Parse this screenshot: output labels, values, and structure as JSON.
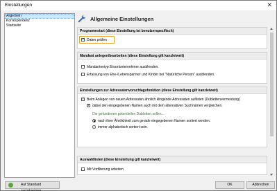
{
  "window": {
    "title": "Einstellungen"
  },
  "nav": {
    "items": [
      {
        "label": "Allgemein"
      },
      {
        "label": "Korrespondenz"
      },
      {
        "label": "Startseite"
      }
    ]
  },
  "header": {
    "title": "Allgemeine Einstellungen"
  },
  "panels": {
    "programmstart": {
      "title": "Programmstart (diese Einstellung ist benutzerspezifisch)",
      "daten_pruefen": "Daten prüfen"
    },
    "mandant": {
      "title": "Mandant anlegen/bearbeiten (diese Einstellung gilt kanzleiweit)",
      "opt1": "Mandantentyp Einzelunternehmer ausblenden.",
      "opt2": "Erfassung von Ehe-/Lebenspartner und Kinder bei \"Natürliche Person\" ausblenden."
    },
    "adressaten": {
      "title": "Einstellungen zur Adressatenvorschlagsfunktion (diese Einstellung gilt kanzleiweit)",
      "opt1": "Beim Anlegen von neuen Adressaten ähnlich klingende Adressaten auflisten (Dublettenvermeidung)",
      "opt2": "dabei den eingegebenen Namen auch mit dem alternativen Suchnamen vergleichen.",
      "group": "Die gefundenen potentiellen Dubletten sollen...",
      "radio1": "nach ihrer Ähnlichkeit zum gerade eingegebenen Namen sortiert werden.",
      "radio2": "immer alphabetisch sortiert sein."
    },
    "auswahllisten": {
      "title": "Auswahllisten (diese Einstellung gilt kanzleiweit)",
      "opt1": "Mit Vorfilterung arbeiten"
    }
  },
  "footer": {
    "reset_label": "Auf Standard zurücksetzen",
    "ok_label": "OK",
    "cancel_label": "Abbrechen"
  }
}
